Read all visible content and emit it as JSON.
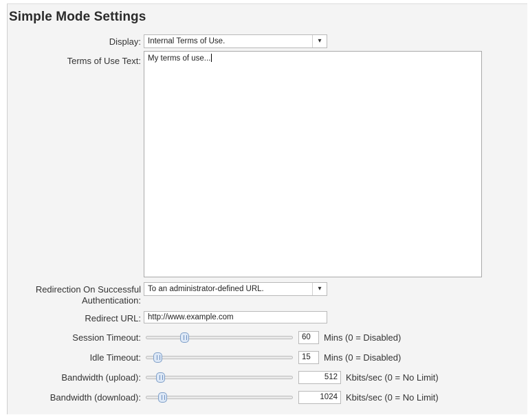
{
  "section_title": "Simple Mode Settings",
  "display": {
    "label": "Display:",
    "value": "Internal Terms of Use."
  },
  "terms": {
    "label": "Terms of Use Text:",
    "value": "My terms of use..."
  },
  "redirection": {
    "label_line1": "Redirection On Successful",
    "label_line2": "Authentication:",
    "value": "To an administrator-defined URL."
  },
  "redirect_url": {
    "label": "Redirect URL:",
    "value": "http://www.example.com"
  },
  "session_timeout": {
    "label": "Session Timeout:",
    "value": "60",
    "unit": "Mins (0 = Disabled)"
  },
  "idle_timeout": {
    "label": "Idle Timeout:",
    "value": "15",
    "unit": "Mins (0 = Disabled)"
  },
  "bw_upload": {
    "label": "Bandwidth (upload):",
    "value": "512",
    "unit": "Kbits/sec (0 = No Limit)"
  },
  "bw_download": {
    "label": "Bandwidth (download):",
    "value": "1024",
    "unit": "Kbits/sec (0 = No Limit)"
  },
  "dropdown_icon": "chevron-down-icon"
}
